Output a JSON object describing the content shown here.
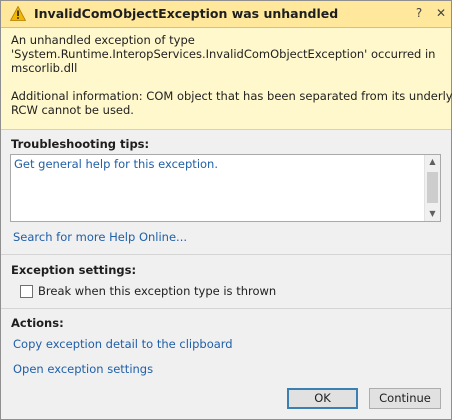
{
  "title": {
    "text": "InvalidComObjectException was unhandled",
    "icon": "warning-icon",
    "help_glyph": "?",
    "close_glyph": "✕"
  },
  "exception": {
    "line1": "An unhandled exception of type",
    "line2": "'System.Runtime.InteropServices.InvalidComObjectException' occurred in",
    "line3": "mscorlib.dll",
    "info_line1": "Additional information: COM object that has been separated from its underlying",
    "info_line2": "RCW cannot be used."
  },
  "troubleshooting": {
    "heading": "Troubleshooting tips:",
    "items": [
      "Get general help for this exception."
    ],
    "search_link": "Search for more Help Online..."
  },
  "exception_settings": {
    "heading": "Exception settings:",
    "checkbox_label": "Break when this exception type is thrown",
    "checked": false
  },
  "actions": {
    "heading": "Actions:",
    "copy_link": "Copy exception detail to the clipboard",
    "open_link": "Open exception settings"
  },
  "buttons": {
    "ok": "OK",
    "continue": "Continue"
  },
  "colors": {
    "title_bar": "#ffe89b",
    "header_bg": "#fff8cc",
    "link": "#1f5fa8",
    "dialog_bg": "#f0f0f0"
  }
}
